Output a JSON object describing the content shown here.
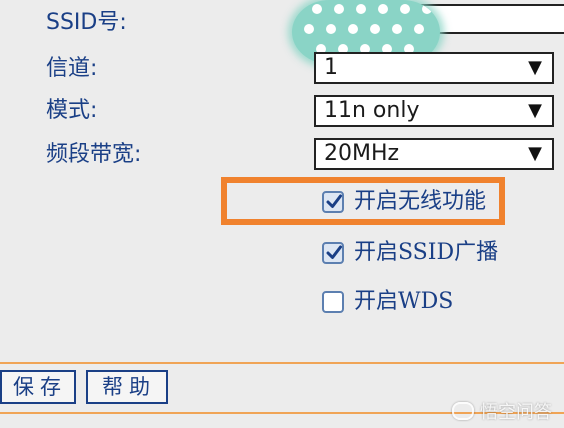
{
  "form": {
    "ssid_label": "SSID号:",
    "channel_label": "信道:",
    "mode_label": "模式:",
    "bandwidth_label": "频段带宽:",
    "channel_value": "1",
    "mode_value": "11n only",
    "bandwidth_value": "20MHz"
  },
  "options": {
    "enable_wireless_label": "开启无线功能",
    "enable_wireless_checked": true,
    "enable_ssid_broadcast_label": "开启SSID广播",
    "enable_ssid_broadcast_checked": true,
    "enable_wds_label": "开启WDS",
    "enable_wds_checked": false
  },
  "buttons": {
    "save_label": "保存",
    "help_label": "帮助"
  },
  "watermark": {
    "text": "悟空问答"
  },
  "colors": {
    "highlight": "#f0822e",
    "label_text": "#1a3f86",
    "redaction": "#8ad4c6"
  },
  "icons": {
    "dropdown": "triangle-down",
    "checkmark": "check"
  }
}
